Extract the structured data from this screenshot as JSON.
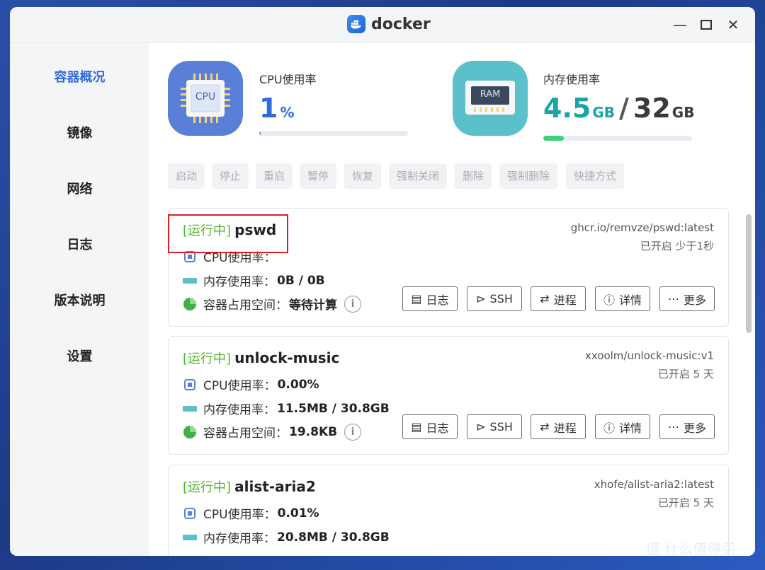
{
  "window": {
    "title": "docker",
    "controls": {
      "minimize": "—",
      "maximize": "☐",
      "close": "✕"
    }
  },
  "sidebar": {
    "items": [
      {
        "label": "容器概况",
        "active": true
      },
      {
        "label": "镜像",
        "active": false
      },
      {
        "label": "网络",
        "active": false
      },
      {
        "label": "日志",
        "active": false
      },
      {
        "label": "版本说明",
        "active": false
      },
      {
        "label": "设置",
        "active": false
      }
    ]
  },
  "stats": {
    "cpu": {
      "label": "CPU使用率",
      "value": "1",
      "unit": "%",
      "icon_text": "CPU",
      "fraction": 0.01
    },
    "memory": {
      "label": "内存使用率",
      "used": "4.5",
      "used_unit": "GB",
      "separator": "/",
      "total": "32",
      "total_unit": "GB",
      "icon_text": "RAM",
      "fraction": 0.14
    }
  },
  "toolbar": {
    "buttons": [
      "启动",
      "停止",
      "重启",
      "暂停",
      "恢复",
      "强制关闭",
      "删除",
      "强制删除",
      "快捷方式"
    ]
  },
  "containers": [
    {
      "status": "[运行中]",
      "name": "pswd",
      "image": "ghcr.io/remvze/pswd:latest",
      "uptime": "已开启 少于1秒",
      "cpu_label": "CPU使用率：",
      "cpu_value": "",
      "mem_label": "内存使用率：",
      "mem_value": "0B / 0B",
      "disk_label": "容器占用空间：",
      "disk_value": "等待计算"
    },
    {
      "status": "[运行中]",
      "name": "unlock-music",
      "image": "xxoolm/unlock-music:v1",
      "uptime": "已开启 5 天",
      "cpu_label": "CPU使用率：",
      "cpu_value": "0.00%",
      "mem_label": "内存使用率：",
      "mem_value": "11.5MB / 30.8GB",
      "disk_label": "容器占用空间：",
      "disk_value": "19.8KB"
    },
    {
      "status": "[运行中]",
      "name": "alist-aria2",
      "image": "xhofe/alist-aria2:latest",
      "uptime": "已开启 5 天",
      "cpu_label": "CPU使用率：",
      "cpu_value": "0.01%",
      "mem_label": "内存使用率：",
      "mem_value": "20.8MB / 30.8GB",
      "disk_label": "",
      "disk_value": ""
    }
  ],
  "card_actions": [
    "日志",
    "SSH",
    "进程",
    "详情",
    "更多"
  ],
  "watermark": "值 什么值得买",
  "colors": {
    "accent": "#2f6be0",
    "running": "#52b52c",
    "highlight": "#e01e22",
    "cpu_icon_bg": "#5a7fd8",
    "ram_icon_bg": "#5bc0c9",
    "cpu_bar": "#7a9be6",
    "ram_bar": "#3fd07a"
  }
}
